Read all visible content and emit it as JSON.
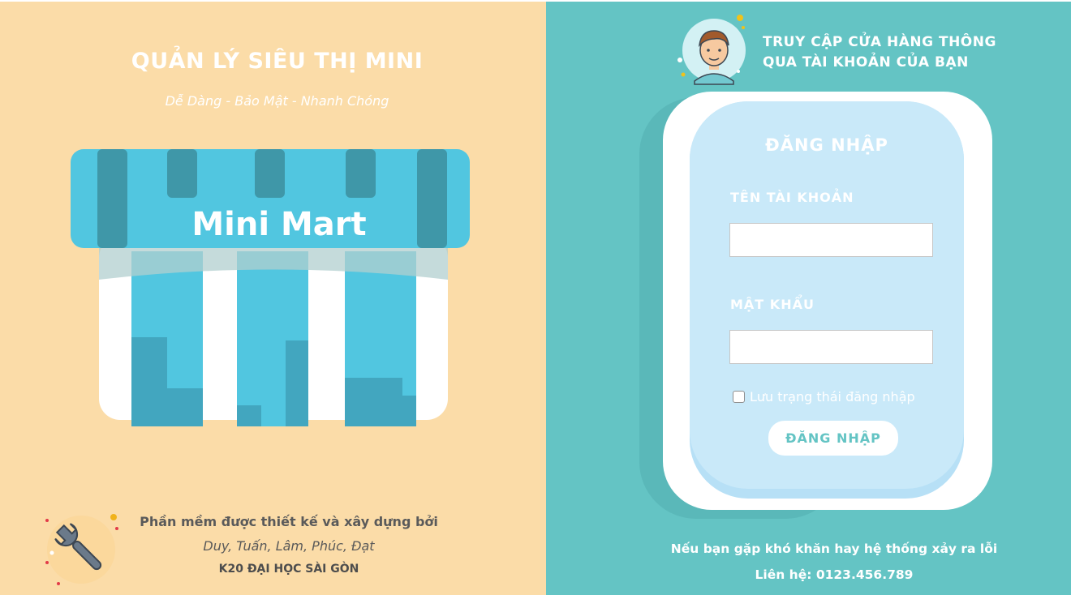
{
  "branding": {
    "title": "QUẢN LÝ SIÊU THỊ MINI",
    "tagline": "Dễ Dàng - Bảo Mật - Nhanh Chóng",
    "store_sign": "Mini Mart"
  },
  "credits": {
    "line1": "Phần mềm được thiết kế và xây dựng bởi",
    "authors": "Duy, Tuấn, Lâm, Phúc, Đạt",
    "school": "K20 ĐẠI HỌC SÀI GÒN"
  },
  "access": {
    "line1": "TRUY CẬP CỬA HÀNG THÔNG",
    "line2": "QUA TÀI KHOẢN CỦA BẠN"
  },
  "login": {
    "title": "ĐĂNG NHẬP",
    "username_label": "TÊN TÀI KHOẢN",
    "username_value": "",
    "password_label": "MẬT KHẨU",
    "password_value": "",
    "remember_label": "Lưu trạng thái đăng nhập",
    "remember_checked": false,
    "button_label": "ĐĂNG NHẬP"
  },
  "support": {
    "line1": "Nếu bạn gặp khó khăn hay hệ thống xảy ra lỗi",
    "line2": "Liên hệ: 0123.456.789"
  },
  "icons": {
    "store": "store-illustration-icon",
    "wrench": "wrench-icon",
    "user": "user-avatar-icon"
  },
  "colors": {
    "left_bg": "#fbdca8",
    "right_bg": "#64c4c4",
    "panel": "#c9e9f9",
    "accent": "#51c6e0"
  }
}
